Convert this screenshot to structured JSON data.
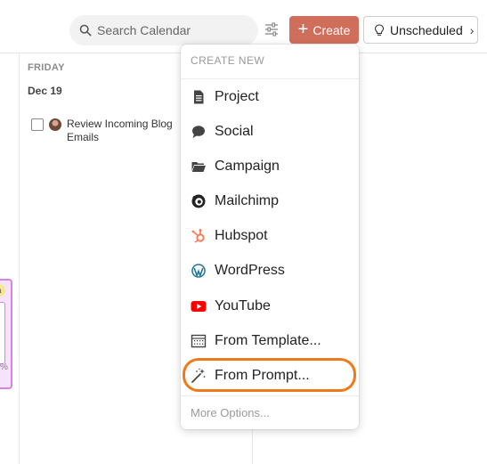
{
  "header": {
    "search_placeholder": "Search Calendar",
    "create_label": "Create",
    "unscheduled_label": "Unscheduled"
  },
  "calendar": {
    "day_name": "FRIDAY",
    "day_date": "Dec 19",
    "task_text": "Review Incoming Blog Emails",
    "side_card_badge": "a",
    "side_card_text": "%"
  },
  "menu": {
    "header": "CREATE NEW",
    "items": [
      {
        "label": "Project",
        "icon": "document-icon"
      },
      {
        "label": "Social",
        "icon": "speech-bubble-icon"
      },
      {
        "label": "Campaign",
        "icon": "folder-icon"
      },
      {
        "label": "Mailchimp",
        "icon": "mailchimp-icon"
      },
      {
        "label": "Hubspot",
        "icon": "hubspot-icon"
      },
      {
        "label": "WordPress",
        "icon": "wordpress-icon"
      },
      {
        "label": "YouTube",
        "icon": "youtube-icon"
      },
      {
        "label": "From Template...",
        "icon": "template-icon"
      },
      {
        "label": "From Prompt...",
        "icon": "magic-wand-icon"
      }
    ],
    "more_options": "More Options...",
    "highlighted_item": "From Prompt..."
  },
  "colors": {
    "create_button": "#d06e5c",
    "highlight_ring": "#f07a1a",
    "hubspot": "#ff7a59",
    "youtube": "#ff0000",
    "wordpress": "#21759b",
    "side_card_border": "#d186e6"
  }
}
